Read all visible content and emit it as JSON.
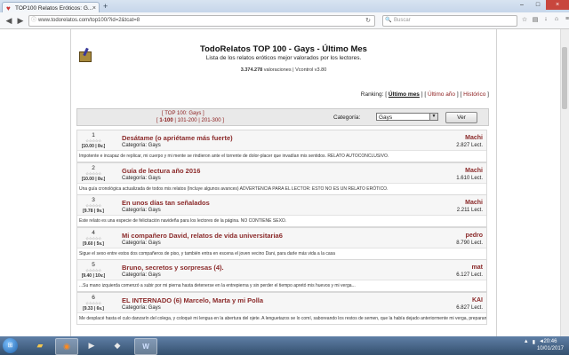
{
  "browser": {
    "tab_title": "TOP100 Relatos Eróticos: G...",
    "tab_close": "×",
    "new_tab": "+",
    "url": "www.todorelatos.com/top100/?id=2&tcat=8",
    "search_placeholder": "Buscar",
    "window_controls": [
      "–",
      "□",
      "×"
    ]
  },
  "header": {
    "title": "TodoRelatos TOP 100 - Gays - Último Mes",
    "subtitle": "Lista de los relatos eróticos mejor valorados por los lectores.",
    "ratings_count": "3.374.278",
    "ratings_text": " valoraciones | Vcontrol v3.80"
  },
  "ranking": {
    "label": "Ranking: ",
    "options": [
      "Último mes",
      "Último año",
      "Histórico"
    ]
  },
  "filter": {
    "top_name": "[ TOP 100: Gays ]",
    "pages": [
      "1-100",
      "101-200",
      "201-300"
    ],
    "category_label": "Categoría:",
    "category_value": "Gays",
    "submit_label": "Ver"
  },
  "entries": [
    {
      "rank": "1",
      "score": "[10.00 | 8v.]",
      "title": "Desátame (o apriétame más fuerte)",
      "category": "Categoría: Gays",
      "author": "Machi",
      "reads": "2.827 Lect.",
      "desc": "Impotente e incapaz de replicar, mi cuerpo y mi mente se rindieron ante el torrente de dolor-placer que invadían mis sentidos. RELATO AUTOCONCLUSIVO."
    },
    {
      "rank": "2",
      "score": "[10.00 | 8v.]",
      "title": "Guía de lectura año 2016",
      "category": "Categoría: Gays",
      "author": "Machi",
      "reads": "1.610 Lect.",
      "desc": "Una guía cronológica actualizada de todos mis relatos (Incluye algunos avances) ADVERTENCIA PARA EL LECTOR: ESTO NO ES UN RELATO ERÓTICO."
    },
    {
      "rank": "3",
      "score": "[9.78 | 9v.]",
      "title": "En unos días tan señalados",
      "category": "Categoría: Gays",
      "author": "Machi",
      "reads": "2.211 Lect.",
      "desc": "Este relato es una especie de felicitación navideña para los lectores de la página. NO CONTIENE SEXO."
    },
    {
      "rank": "4",
      "score": "[9.60 | 5v.]",
      "title": "Mi compañero David, relatos de vida universitaria6",
      "category": "Categoría: Gays",
      "author": "pedro",
      "reads": "8.790 Lect.",
      "desc": "Sigue el sexo entre estos dos compañeros de piso, y también entra en escena el joven vecino Dani, para darle más vida a la casa"
    },
    {
      "rank": "5",
      "score": "[9.40 | 10v.]",
      "title": "Bruno, secretos y sorpresas (4).",
      "category": "Categoría: Gays",
      "author": "mat",
      "reads": "6.127 Lect.",
      "desc": "...Su mano izquierda comenzó a subir por mi pierna hasta detenerse en la entrepierna y sin perder el tiempo apretó mis huevos y mi verga..."
    },
    {
      "rank": "6",
      "score": "[9.33 | 6v.]",
      "title": "EL INTERNADO (6) Marcelo, Marta y mi Polla",
      "category": "Categoría: Gays",
      "author": "KAI",
      "reads": "6.827 Lect.",
      "desc": "Me desplacé hasta el culo danzarín del colega, y coloqué mi lengua en la abertura del ojete. A lenguetazos se lo comí, saboreando los restos de semen, que la había dejado anteriormente mi verga, preparandoselo para que albergara de nuevo mi tripote en..."
    }
  ],
  "taskbar": {
    "time": "20:46",
    "date": "10/01/2017"
  }
}
